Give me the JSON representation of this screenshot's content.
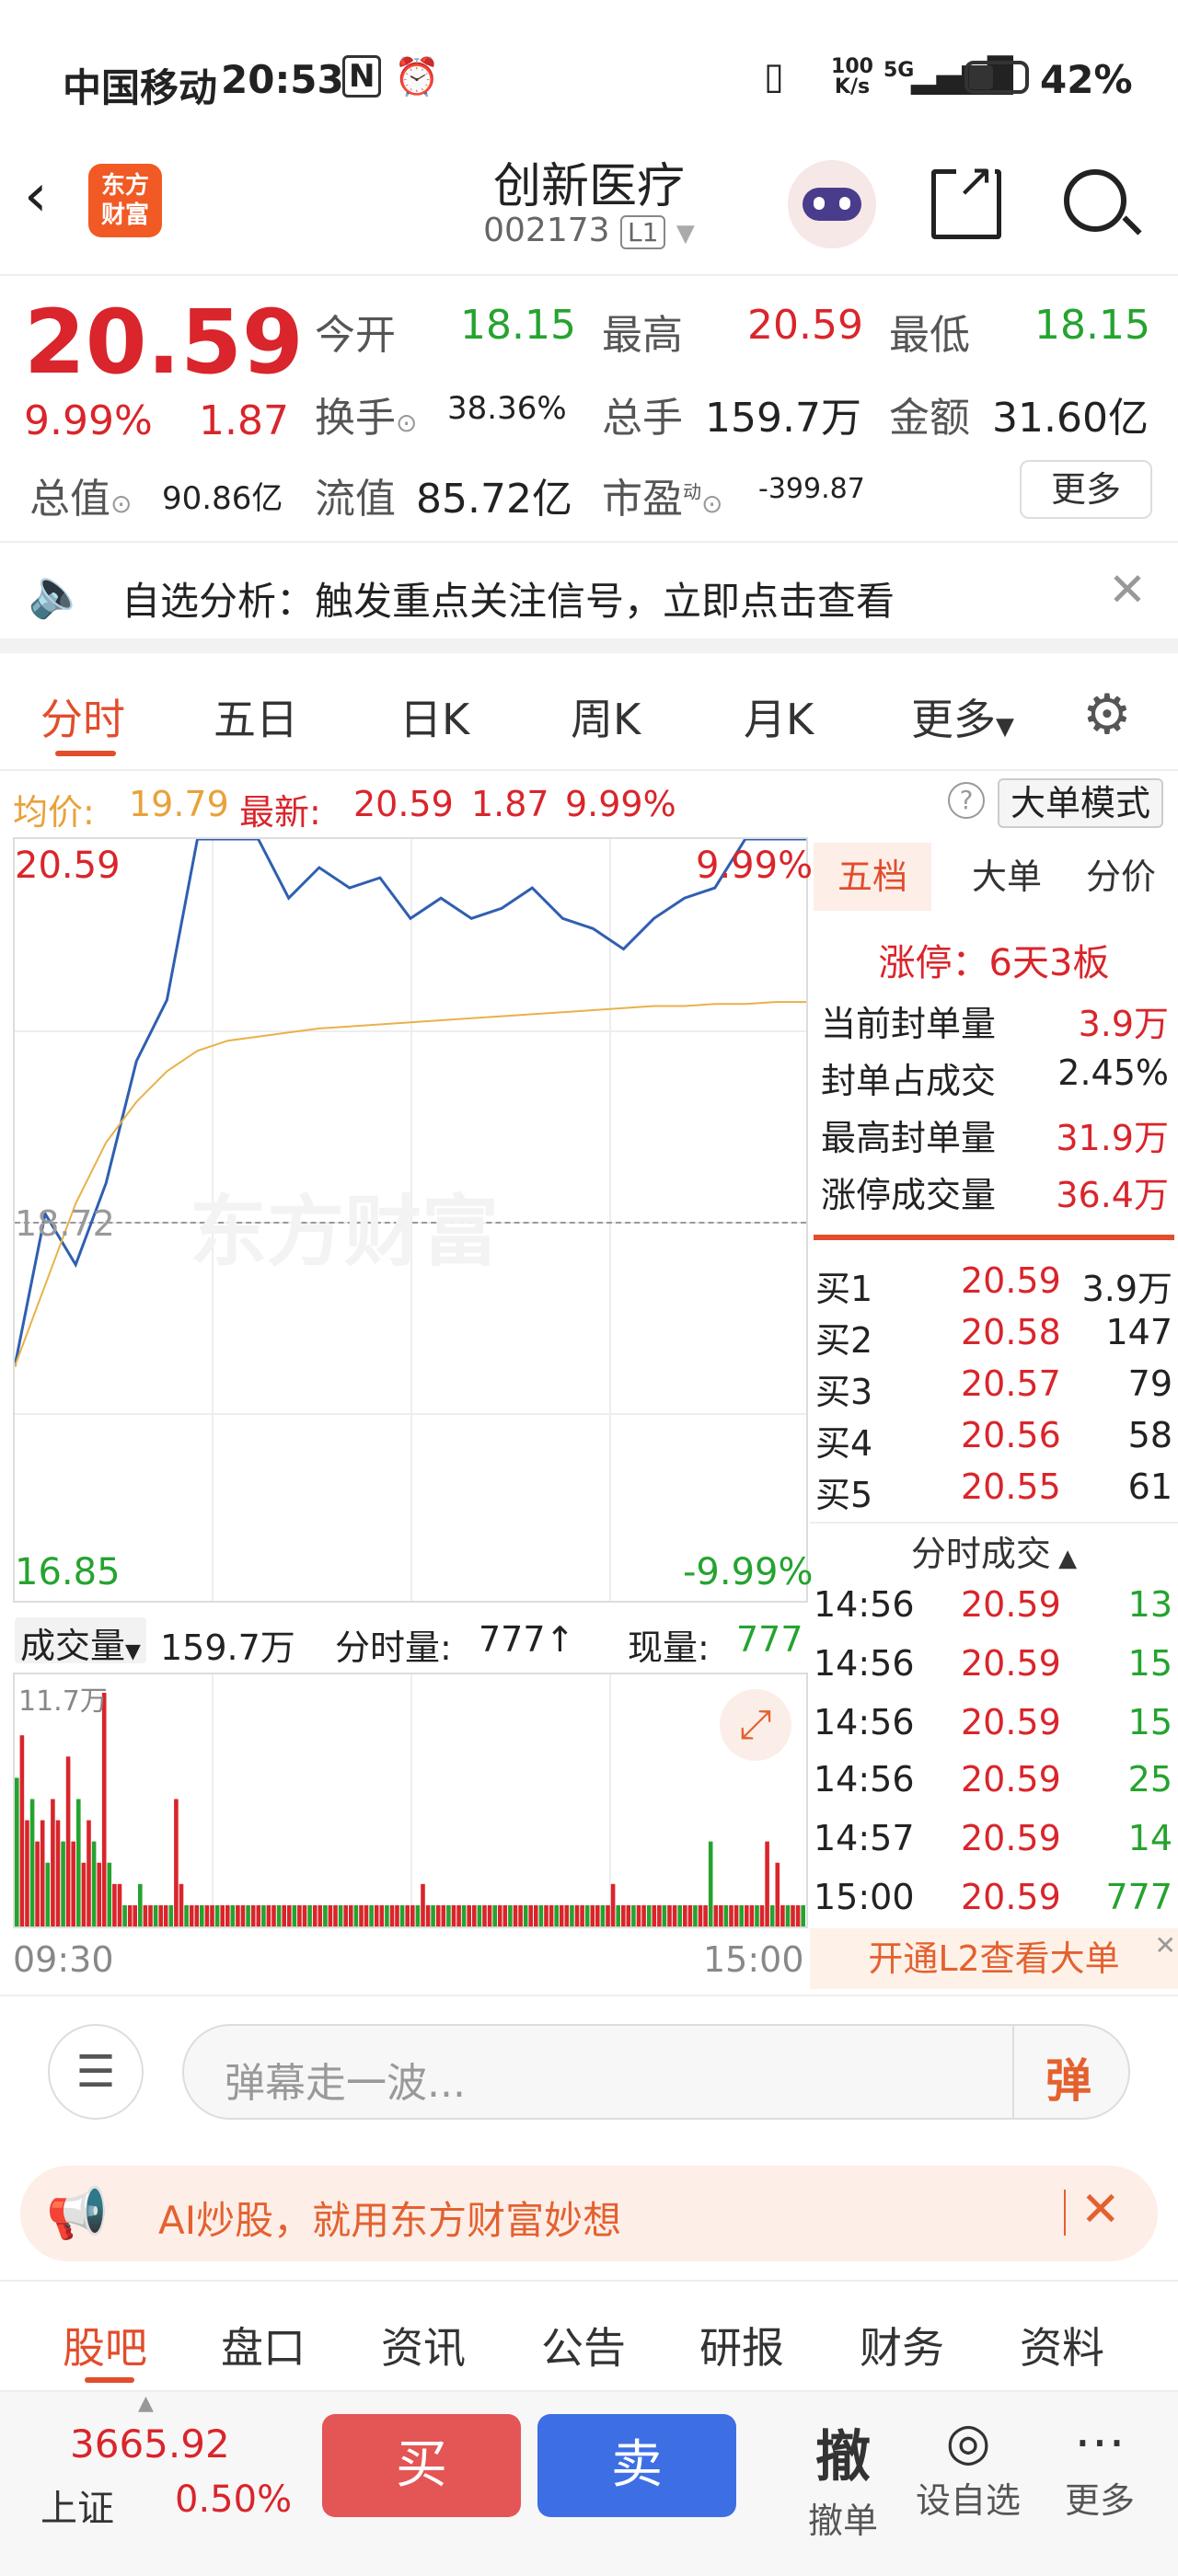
{
  "status": {
    "carrier": "中国移动",
    "time": "20:53",
    "net_speed": "100 K/s",
    "signal": "5G",
    "battery": "42%"
  },
  "header": {
    "logo_text": "东方财富",
    "title": "创新医疗",
    "code": "002173",
    "level": "L1"
  },
  "quote": {
    "price": "20.59",
    "change_pct": "9.99%",
    "change": "1.87",
    "open_label": "今开",
    "open": "18.15",
    "high_label": "最高",
    "high": "20.59",
    "low_label": "最低",
    "low": "18.15",
    "turnover_label": "换手",
    "turnover": "38.36%",
    "volume_label": "总手",
    "volume": "159.7万",
    "amount_label": "金额",
    "amount": "31.60亿",
    "mktcap_label": "总值",
    "mktcap": "90.86亿",
    "float_label": "流值",
    "float": "85.72亿",
    "pe_label": "市盈",
    "pe_sup": "动",
    "pe": "-399.87",
    "more_button": "更多"
  },
  "notice": {
    "text": "自选分析：触发重点关注信号，立即点击查看"
  },
  "tabs": [
    "分时",
    "五日",
    "日K",
    "周K",
    "月K",
    "更多"
  ],
  "info_line": {
    "avg_label": "均价:",
    "avg": "19.79",
    "latest_label": "最新:",
    "latest": "20.59",
    "change": "1.87",
    "pct": "9.99%",
    "mode_button": "大单模式"
  },
  "chart_labels": {
    "top_price": "20.59",
    "top_pct": "9.99%",
    "mid_price": "18.72",
    "bottom_price": "16.85",
    "bottom_pct": "-9.99%",
    "watermark": "东方财富"
  },
  "volume_header": {
    "selector": "成交量",
    "total": "159.7万",
    "fenshi_label": "分时量:",
    "fenshi": "777↑",
    "now_label": "现量:",
    "now": "777",
    "max": "11.7万"
  },
  "time_axis": {
    "start": "09:30",
    "end": "15:00"
  },
  "right_tabs": [
    "五档",
    "大单",
    "分价"
  ],
  "limit": {
    "title": "涨停：6天3板",
    "rows": [
      {
        "label": "当前封单量",
        "value": "3.9万"
      },
      {
        "label": "封单占成交",
        "value": "2.45%"
      },
      {
        "label": "最高封单量",
        "value": "31.9万"
      },
      {
        "label": "涨停成交量",
        "value": "36.4万"
      }
    ]
  },
  "orderbook": [
    {
      "label": "买1",
      "price": "20.59",
      "vol": "3.9万"
    },
    {
      "label": "买2",
      "price": "20.58",
      "vol": "147"
    },
    {
      "label": "买3",
      "price": "20.57",
      "vol": "79"
    },
    {
      "label": "买4",
      "price": "20.56",
      "vol": "58"
    },
    {
      "label": "买5",
      "price": "20.55",
      "vol": "61"
    }
  ],
  "trades_title": "分时成交",
  "trades": [
    {
      "time": "14:56",
      "price": "20.59",
      "vol": "13"
    },
    {
      "time": "14:56",
      "price": "20.59",
      "vol": "15"
    },
    {
      "time": "14:56",
      "price": "20.59",
      "vol": "15"
    },
    {
      "time": "14:56",
      "price": "20.59",
      "vol": "25"
    },
    {
      "time": "14:57",
      "price": "20.59",
      "vol": "14"
    },
    {
      "time": "15:00",
      "price": "20.59",
      "vol": "777"
    }
  ],
  "l2_banner": "开通L2查看大单",
  "danmu": {
    "placeholder": "弹幕走一波...",
    "send": "弹"
  },
  "ai_banner": "AI炒股，就用东方财富妙想",
  "bottom_tabs": [
    "股吧",
    "盘口",
    "资讯",
    "公告",
    "研报",
    "财务",
    "资料"
  ],
  "footer": {
    "index_value": "3665.92",
    "index_name": "上证",
    "index_pct": "0.50%",
    "buy": "买",
    "sell": "卖",
    "cancel_glyph": "撤",
    "cancel": "撤单",
    "watchlist": "设自选",
    "more": "更多"
  },
  "chart_data": {
    "type": "line",
    "x_range": [
      "09:30",
      "15:00"
    ],
    "ylim": [
      16.85,
      20.59
    ],
    "reference": 18.72,
    "series": [
      {
        "values": [
          18.0,
          18.75,
          18.5,
          18.9,
          19.5,
          19.8,
          20.59,
          20.59,
          20.59,
          20.3,
          20.45,
          20.35,
          20.4,
          20.2,
          20.3,
          20.2,
          20.25,
          20.35,
          20.2,
          20.15,
          20.05,
          20.2,
          20.3,
          20.35,
          20.59,
          20.59,
          20.59
        ]
      },
      {
        "values": [
          18.0,
          18.4,
          18.8,
          19.1,
          19.3,
          19.45,
          19.55,
          19.6,
          19.62,
          19.64,
          19.66,
          19.67,
          19.68,
          19.69,
          19.7,
          19.71,
          19.72,
          19.73,
          19.74,
          19.75,
          19.76,
          19.77,
          19.77,
          19.78,
          19.78,
          19.79,
          19.79
        ]
      }
    ],
    "volume": {
      "max": "11.7万",
      "values": [
        7,
        9,
        5,
        6,
        4,
        5,
        3,
        6,
        5,
        4,
        8,
        4,
        6,
        3,
        5,
        4,
        3,
        11,
        3,
        2,
        2,
        1,
        1,
        1,
        2,
        1,
        1,
        1,
        1,
        1,
        1,
        6,
        2,
        1,
        1,
        1,
        1,
        1,
        1,
        1,
        1,
        1,
        1,
        1,
        1,
        1,
        1,
        1,
        1,
        1,
        1,
        1,
        1,
        1,
        1,
        1,
        1,
        1,
        1,
        1,
        1,
        1,
        1,
        1,
        1,
        1,
        1,
        1,
        1,
        1,
        1,
        1,
        1,
        1,
        1,
        1,
        1,
        1,
        1,
        2,
        1,
        1,
        1,
        1,
        1,
        1,
        1,
        1,
        1,
        1,
        1,
        1,
        1,
        1,
        1,
        1,
        1,
        1,
        1,
        1,
        1,
        1,
        1,
        1,
        1,
        1,
        1,
        1,
        1,
        1,
        1,
        1,
        1,
        1,
        1,
        1,
        2,
        1,
        1,
        1,
        1,
        1,
        1,
        1,
        1,
        1,
        1,
        1,
        1,
        1,
        1,
        1,
        1,
        1,
        1,
        4,
        1,
        1,
        1,
        1,
        1,
        1,
        1,
        1,
        1,
        1,
        4,
        1,
        3,
        1,
        1,
        1,
        1,
        1
      ]
    }
  }
}
